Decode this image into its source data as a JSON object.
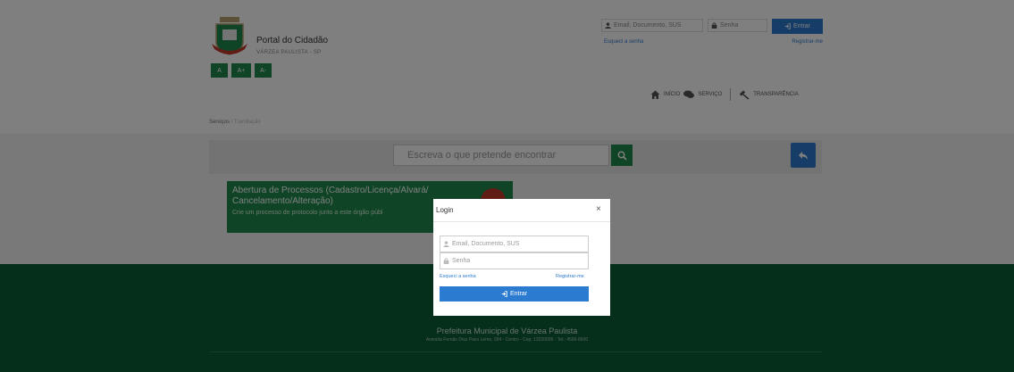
{
  "header": {
    "portal_title": "Portal do Cidadão",
    "city": "VÁRZEA PAULISTA - SP",
    "font_buttons": [
      "A",
      "A+",
      "A-"
    ]
  },
  "top_login": {
    "user_placeholder": "Email, Documento, SUS",
    "password_placeholder": "Senha",
    "submit_label": "Entrar",
    "forgot_label": "Esqueci a senha",
    "register_label": "Registrar-me"
  },
  "nav": {
    "items": [
      "INÍCIO",
      "SERVIÇO",
      "TRANSPARÊNCIA"
    ]
  },
  "breadcrumb": {
    "items": [
      "Serviços",
      "Tramitação"
    ]
  },
  "search": {
    "placeholder": "Escreva o que pretende encontrar"
  },
  "card": {
    "title": "Abertura de Processos (Cadastro/Licença/Alvará/ Cancelamento/Alteração)",
    "description": "Crie um processo de protocolo junto a este órgão públ"
  },
  "footer": {
    "city_name": "Prefeitura Municipal de Várzea Paulista",
    "address": "Avenida Fernão Dias Paes Leme, 284 - Centro - Cep: 13220005 - Tel.: 4596-8600"
  },
  "modal": {
    "title": "Login",
    "close_glyph": "×",
    "user_placeholder": "Email, Documento, SUS",
    "password_placeholder": "Senha",
    "forgot_label": "Esqueci a senha",
    "register_label": "Registrar-me",
    "submit_label": "Entrar"
  },
  "colors": {
    "accent_blue": "#2b7bd0",
    "brand_green": "#1f8a4c",
    "footer_green": "#0b5c36"
  }
}
